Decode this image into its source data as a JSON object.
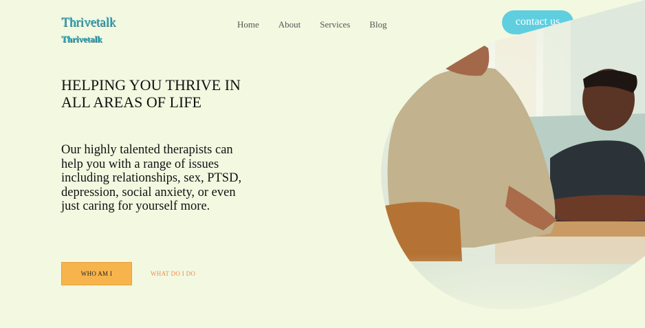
{
  "brand": {
    "name": "Thrivetalk",
    "sub": "Thrivetalk"
  },
  "nav": {
    "items": [
      "Home",
      "About",
      "Services",
      "Blog"
    ]
  },
  "header": {
    "contact_label": "contact us"
  },
  "hero": {
    "headline": "HELPING YOU THRIVE IN ALL AREAS OF LIFE",
    "description": "Our highly talented therapists can help you with a range of issues including relationships, sex, PTSD, depression, social anxiety, or even just caring for yourself more.",
    "primary_button": "WHO AM I",
    "secondary_link": "WHAT DO I DO"
  },
  "colors": {
    "background": "#f3f8e1",
    "brand": "#3fb6c9",
    "contact_button": "#5fcfe0",
    "primary_button": "#f7b44c",
    "secondary_link": "#f08a4b"
  }
}
